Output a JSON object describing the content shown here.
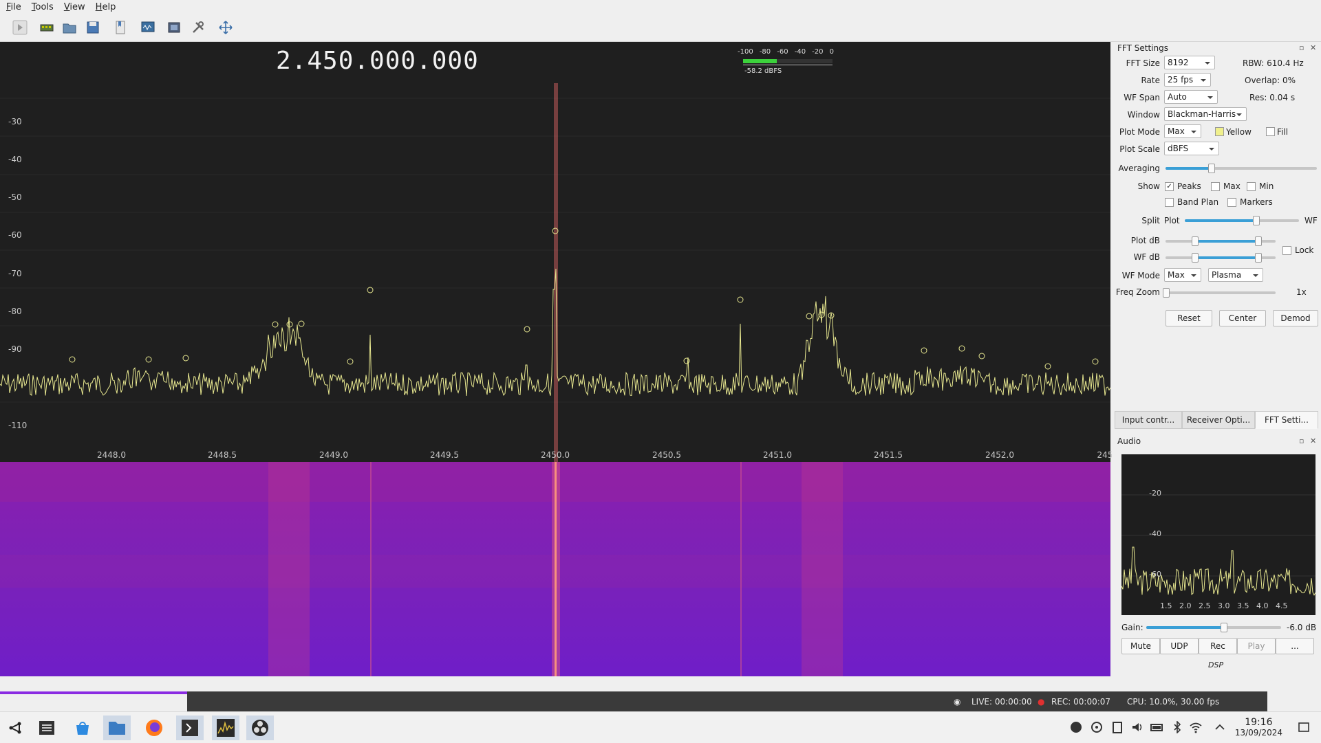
{
  "menu": [
    "File",
    "Tools",
    "View",
    "Help"
  ],
  "toolbar_icons": [
    "play-icon",
    "hardware-icon",
    "open-icon",
    "save-icon",
    "bookmark-icon",
    "iq-tool-icon",
    "screenshot-icon",
    "settings-icon",
    "fullscreen-icon"
  ],
  "fft": {
    "frequency": "2.450.000.000",
    "meter_scale": [
      "-100",
      "-80",
      "-60",
      "-40",
      "-20",
      "0"
    ],
    "meter_value": "-58.2 dBFS",
    "meter_level": 0.38,
    "y_ticks": [
      "-30",
      "-40",
      "-50",
      "-60",
      "-70",
      "-80",
      "-90",
      "-110"
    ],
    "x_ticks": [
      "2448.0",
      "2448.5",
      "2449.0",
      "2449.5",
      "2450.0",
      "2450.5",
      "2451.0",
      "2451.5",
      "2452.0",
      "245"
    ]
  },
  "panel": {
    "title": "FFT Settings",
    "fft_size_label": "FFT Size",
    "fft_size": "8192",
    "rbw": "RBW: 610.4 Hz",
    "rate_label": "Rate",
    "rate": "25 fps",
    "overlap": "Overlap: 0%",
    "wfspan_label": "WF Span",
    "wfspan": "Auto",
    "res": "Res: 0.04 s",
    "window_label": "Window",
    "window": "Blackman-Harris",
    "plotmode_label": "Plot Mode",
    "plotmode": "Max",
    "color_label": "Yellow",
    "fill_label": "Fill",
    "plotscale_label": "Plot Scale",
    "plotscale": "dBFS",
    "averaging_label": "Averaging",
    "averaging_level": 0.3,
    "show_label": "Show",
    "peaks_label": "Peaks",
    "max_label": "Max",
    "min_label": "Min",
    "bandplan_label": "Band Plan",
    "markers_label": "Markers",
    "split_label": "Split",
    "split_plot": "Plot",
    "split_wf": "WF",
    "split_level": 0.62,
    "plotdb_label": "Plot dB",
    "plotdb_low": 0.26,
    "plotdb_high": 0.84,
    "lock_label": "Lock",
    "wfdb_label": "WF dB",
    "wfdb_low": 0.26,
    "wfdb_high": 0.84,
    "wfmode_label": "WF Mode",
    "wfmode": "Max",
    "wfcolor": "Plasma",
    "freqzoom_label": "Freq Zoom",
    "freqzoom_value": "1x",
    "freqzoom_level": 0.0,
    "reset_label": "Reset",
    "center_label": "Center",
    "demod_label": "Demod",
    "tabs": [
      "Input contr...",
      "Receiver Opti...",
      "FFT Setti..."
    ]
  },
  "audio": {
    "title": "Audio",
    "y_ticks": [
      "-20",
      "-40",
      "-60"
    ],
    "x_ticks": [
      "1.5",
      "2.0",
      "2.5",
      "3.0",
      "3.5",
      "4.0",
      "4.5"
    ],
    "gain_label": "Gain:",
    "gain_value": "-6.0 dB",
    "gain_level": 0.57,
    "buttons": [
      "Mute",
      "UDP",
      "Rec",
      "Play",
      "..."
    ],
    "dsp": "DSP"
  },
  "status": {
    "live": "LIVE: 00:00:00",
    "rec": "REC: 00:00:07",
    "cpu": "CPU: 10.0%, 30.00 fps"
  },
  "taskbar": {
    "apps": [
      "app-launcher-icon",
      "settings-icon",
      "store-icon",
      "files-icon",
      "firefox-icon",
      "terminal-icon",
      "gqrx-icon",
      "obs-icon"
    ],
    "time": "19:16",
    "date": "13/09/2024"
  },
  "colors": {
    "spectrum": "#e8e890",
    "waterfall": "#7a1bc0",
    "accent": "#3a9fd6"
  }
}
